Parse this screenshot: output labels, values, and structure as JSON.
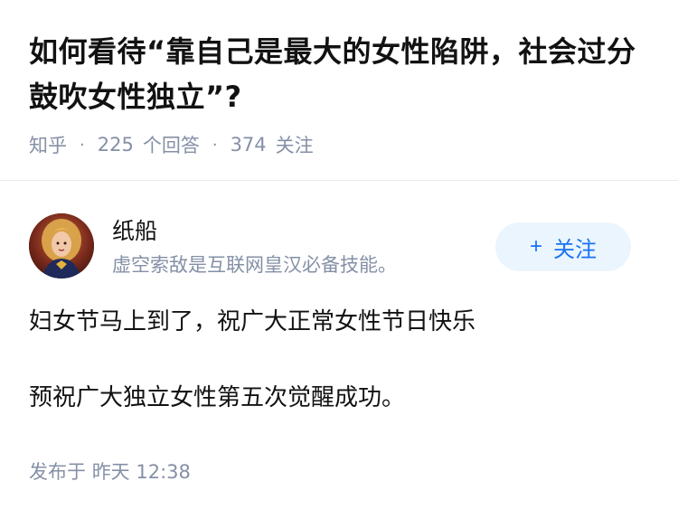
{
  "question": {
    "title": "如何看待“靠自己是最大的女性陷阱，社会过分鼓吹女性独立”?",
    "source": "知乎",
    "answers_count": "225",
    "answers_label": "个回答",
    "followers_count": "374",
    "followers_label": "关注"
  },
  "author": {
    "name": "纸船",
    "bio": "虚空索敌是互联网皇汉必备技能。",
    "follow_label": "关注",
    "follow_icon": "plus-icon"
  },
  "answer": {
    "paragraphs": [
      "妇女节马上到了，祝广大正常女性节日快乐",
      "预祝广大独立女性第五次觉醒成功。"
    ],
    "published_prefix": "发布于",
    "published_time": "昨天 12:38"
  },
  "colors": {
    "accent": "#1772f6",
    "button_bg": "#ebf5fd",
    "muted": "#8590a6",
    "text": "#121212"
  }
}
